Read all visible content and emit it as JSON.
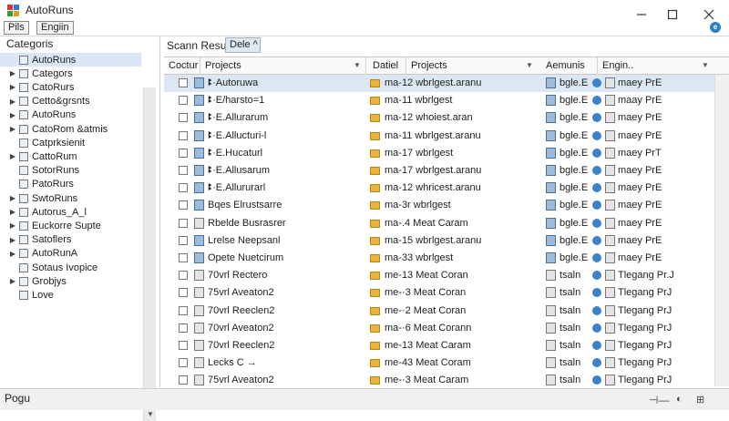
{
  "window": {
    "title": "AutoRuns"
  },
  "menu": {
    "items": [
      "Pils",
      "Engiin"
    ]
  },
  "sidebar": {
    "header": "Categoris",
    "items": [
      {
        "label": "AutoRuns",
        "toggle": ""
      },
      {
        "label": "Categors",
        "toggle": "▶"
      },
      {
        "label": "CatoRurs",
        "toggle": "▶"
      },
      {
        "label": "Cetto&grsnts",
        "toggle": "▶"
      },
      {
        "label": "AutoRuns",
        "toggle": "▶"
      },
      {
        "label": "CatoRom &atmis",
        "toggle": "▶"
      },
      {
        "label": "Catprksienit",
        "toggle": ""
      },
      {
        "label": "CattoRum",
        "toggle": "▶"
      },
      {
        "label": "SotorRuns",
        "toggle": ""
      },
      {
        "label": "PatoRurs",
        "toggle": ""
      },
      {
        "label": "SwtoRuns",
        "toggle": "▶"
      },
      {
        "label": "Autorus_A_l",
        "toggle": "▶"
      },
      {
        "label": "Euckorre Supte",
        "toggle": "▶"
      },
      {
        "label": "Satoflers",
        "toggle": "▶"
      },
      {
        "label": "AutoRunA",
        "toggle": "▶"
      },
      {
        "label": "Sotaus Ivopice",
        "toggle": ""
      },
      {
        "label": "Grobjys",
        "toggle": "▶"
      },
      {
        "label": "Love",
        "toggle": ""
      }
    ]
  },
  "toolbar": {
    "scan_label": "Scann Result",
    "delete_label": "Dele ^"
  },
  "columns": [
    "Coctur",
    "Projects",
    "Datiel",
    "Projects",
    "Aemunis",
    "Engin.."
  ],
  "rows": [
    {
      "name": "ꔪ·Autoruwa",
      "detail": "ma-12 wbrlgest.aranu",
      "sig": "bgle.E",
      "company": "maey PrE",
      "icon": "sig",
      "selected": true
    },
    {
      "name": "ꔪ·E/harsto=1",
      "detail": "ma-11 wbrlgest",
      "sig": "bgle.E",
      "company": "maay PrE",
      "icon": "sig",
      "selected": false
    },
    {
      "name": "ꔪ·E.Allurarum",
      "detail": "ma-12 whoiest.aran",
      "sig": "bgle.E",
      "company": "maey PrE",
      "icon": "sig",
      "selected": false
    },
    {
      "name": "ꔪ·E.Allucturi-l",
      "detail": "ma-11 wbrlgest.aranu",
      "sig": "bgle.E",
      "company": "maey PrE",
      "icon": "sig",
      "selected": false
    },
    {
      "name": "ꔪ·E.Hucaturl",
      "detail": "ma-17 wbrlgest",
      "sig": "bgle.E",
      "company": "maey PrT",
      "icon": "sig",
      "selected": false
    },
    {
      "name": "ꔪ·E.Allusarum",
      "detail": "ma-17 wbrlgest.aranu",
      "sig": "bgle.E",
      "company": "maey PrE",
      "icon": "sig",
      "selected": false
    },
    {
      "name": "ꔪ·E.Allururarl",
      "detail": "ma-12 whricest.aranu",
      "sig": "bgle.E",
      "company": "maey PrE",
      "icon": "sig",
      "selected": false
    },
    {
      "name": "Bqes Elrustsarre",
      "detail": "ma-3r wbrlgest",
      "sig": "bgle.E",
      "company": "maey PrE",
      "icon": "sig",
      "selected": false
    },
    {
      "name": "Rbelde Busrasrer",
      "detail": "ma-.4  Meat Caram",
      "sig": "bgle.E",
      "company": "maey PrE",
      "icon": "exe",
      "selected": false
    },
    {
      "name": "Lrelse Neepsanl",
      "detail": "ma-15 wbrlgest.aranu",
      "sig": "bgle.E",
      "company": "maey PrE",
      "icon": "sig",
      "selected": false
    },
    {
      "name": "Opete Nuetcirum",
      "detail": "ma-33 wbrlgest",
      "sig": "bgle.E",
      "company": "maey PrE",
      "icon": "sig",
      "selected": false
    },
    {
      "name": "70vrl Rectero",
      "detail": "me-13  Meat Coran",
      "sig": "tsaln",
      "company": "Tlegang Pr.J",
      "icon": "exe",
      "selected": false
    },
    {
      "name": "75vrl Aveaton2",
      "detail": "me-·3  Meat Coran",
      "sig": "tsaln",
      "company": "Tlegang PrJ",
      "icon": "exe",
      "selected": false
    },
    {
      "name": "70vrl Reeclen2",
      "detail": "me-·2  Meat Coran",
      "sig": "tsaln",
      "company": "Tlegang PrJ",
      "icon": "exe",
      "selected": false
    },
    {
      "name": "70vrl Aveaton2",
      "detail": "ma-·6  Meat Corann",
      "sig": "tsaln",
      "company": "Tlegang PrJ",
      "icon": "fold",
      "selected": false
    },
    {
      "name": "70vrl Reeclen2",
      "detail": "me-13  Meat Caram",
      "sig": "tsaln",
      "company": "Tlegang PrJ",
      "icon": "exe",
      "selected": false
    },
    {
      "name": "Lecks C  →",
      "detail": "me-43  Meat Coram",
      "sig": "tsaln",
      "company": "Tlegang PrJ",
      "icon": "exe",
      "selected": false
    },
    {
      "name": "75vrl Aveaton2",
      "detail": "me-·3  Meat Caram",
      "sig": "tsaln",
      "company": "Tlegang PrJ",
      "icon": "exe",
      "selected": false
    }
  ],
  "status": {
    "text": "Pogu"
  },
  "colors": {
    "selection": "#dde7f3",
    "accent": "#2f7fc6",
    "folder": "#e8b339"
  }
}
